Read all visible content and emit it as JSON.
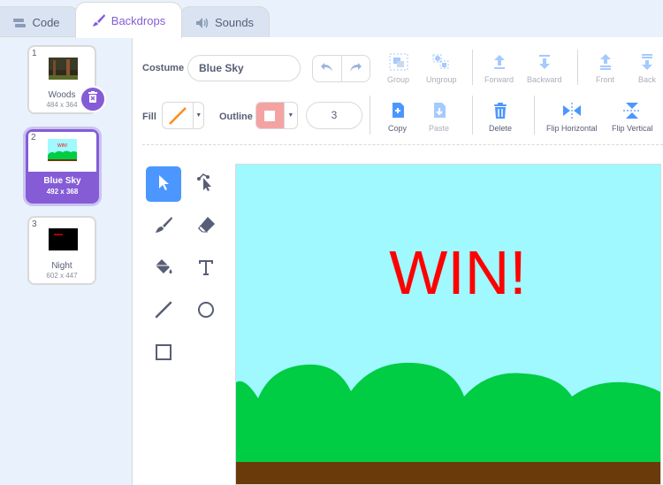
{
  "tabs": [
    {
      "label": "Code",
      "icon": "code-icon",
      "active": false
    },
    {
      "label": "Backdrops",
      "icon": "brush-icon",
      "active": true
    },
    {
      "label": "Sounds",
      "icon": "speaker-icon",
      "active": false
    }
  ],
  "backdrops": [
    {
      "number": "1",
      "name": "Woods",
      "size": "484 x 364",
      "selected": false
    },
    {
      "number": "2",
      "name": "Blue Sky",
      "size": "492 x 368",
      "selected": true
    },
    {
      "number": "3",
      "name": "Night",
      "size": "602 x 447",
      "selected": false
    }
  ],
  "editor": {
    "costume_label": "Costume",
    "costume_name": "Blue Sky",
    "fill_label": "Fill",
    "outline_label": "Outline",
    "outline_width": "3",
    "arrange": {
      "group": "Group",
      "ungroup": "Ungroup",
      "forward": "Forward",
      "backward": "Backward",
      "front": "Front",
      "back": "Back"
    },
    "actions": {
      "copy": "Copy",
      "paste": "Paste",
      "delete": "Delete",
      "flip_h": "Flip Horizontal",
      "flip_v": "Flip Vertical"
    }
  },
  "canvas": {
    "text": "WIN!",
    "colors": {
      "sky": "#9ff9ff",
      "bushes": "#00cc44",
      "ground": "#6b3a0a",
      "text": "#ff0000"
    }
  },
  "colors": {
    "accent": "#855cd6",
    "tool_active": "#4c97ff",
    "text": "#575e75",
    "delete": "#4c97ff"
  }
}
